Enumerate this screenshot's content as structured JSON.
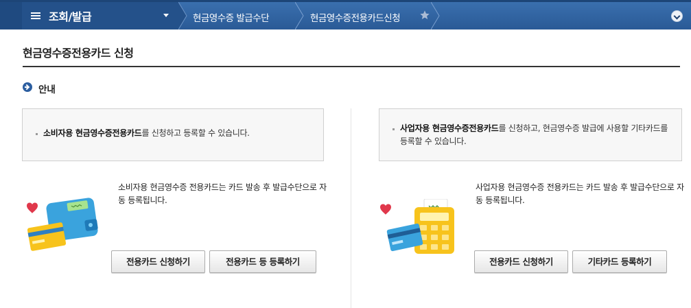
{
  "nav": {
    "menu_title": "조회/발급",
    "breadcrumbs": [
      "현금영수증 발급수단",
      "현금영수증전용카드신청"
    ],
    "icons": [
      "hamburger-icon",
      "caret-down-icon",
      "star-icon",
      "chevron-down-icon"
    ]
  },
  "page": {
    "title": "현금영수증전용카드 신청",
    "section_title": "안내"
  },
  "left": {
    "notice_bold": "소비자용 현금영수증전용카드",
    "notice_rest": "를 신청하고 등록할 수 있습니다.",
    "description": "소비자용 현금영수증 전용카드는 카드 발송 후 발급수단으로 자동 등록됩니다.",
    "buttons": [
      "전용카드 신청하기",
      "전용카드 등 등록하기"
    ]
  },
  "right": {
    "notice_bold": "사업자용 현금영수증전용카드",
    "notice_rest": "를 신청하고, 현금영수증 발급에 사용할 기타카드를 등록할 수 있습니다.",
    "description": "사업자용 현금영수증 전용카드는 카드 발송 후 발급수단으로 자동 등록됩니다.",
    "buttons": [
      "전용카드 신청하기",
      "기타카드 등록하기"
    ]
  },
  "colors": {
    "nav_bg": "#2a5a96",
    "accent": "#2c5ea0",
    "wallet": "#3aa3dd",
    "calculator": "#f7c31c",
    "heart": "#e0384b"
  }
}
